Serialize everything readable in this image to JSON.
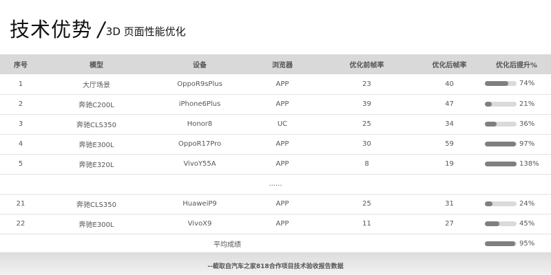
{
  "heading": {
    "main": "技术优势",
    "slash": "/",
    "sub": "3D 页面性能优化"
  },
  "table": {
    "headers": [
      "序号",
      "模型",
      "设备",
      "浏览器",
      "优化前帧率",
      "优化后帧率",
      "优化后提升%"
    ],
    "rows": [
      {
        "id": "1",
        "model": "大厅场景",
        "device": "OppoR9sPlus",
        "browser": "APP",
        "before": "23",
        "after": "40",
        "gain": 74,
        "gain_label": "74%"
      },
      {
        "id": "2",
        "model": "奔驰C200L",
        "device": "iPhone6Plus",
        "browser": "APP",
        "before": "39",
        "after": "47",
        "gain": 21,
        "gain_label": "21%"
      },
      {
        "id": "3",
        "model": "奔驰CLS350",
        "device": "Honor8",
        "browser": "UC",
        "before": "25",
        "after": "34",
        "gain": 36,
        "gain_label": "36%"
      },
      {
        "id": "4",
        "model": "奔驰E300L",
        "device": "OppoR17Pro",
        "browser": "APP",
        "before": "30",
        "after": "59",
        "gain": 97,
        "gain_label": "97%"
      },
      {
        "id": "5",
        "model": "奔驰E320L",
        "device": "VivoY55A",
        "browser": "APP",
        "before": "8",
        "after": "19",
        "gain": 138,
        "gain_label": "138%"
      }
    ],
    "ellipsis": "......",
    "rows_after": [
      {
        "id": "21",
        "model": "奔驰CLS350",
        "device": "HuaweiP9",
        "browser": "APP",
        "before": "25",
        "after": "31",
        "gain": 24,
        "gain_label": "24%"
      },
      {
        "id": "22",
        "model": "奔驰E300L",
        "device": "VivoX9",
        "browser": "APP",
        "before": "11",
        "after": "27",
        "gain": 45,
        "gain_label": "45%"
      }
    ],
    "average": {
      "label": "平均成绩",
      "gain": 95,
      "gain_label": "95%"
    }
  },
  "footer": "--截取自汽车之家818合作项目技术验收报告数据",
  "colors": {
    "header_bg": "#d9d9d9",
    "bar_fill": "#7f7f7f",
    "bar_track": "#dadada"
  }
}
